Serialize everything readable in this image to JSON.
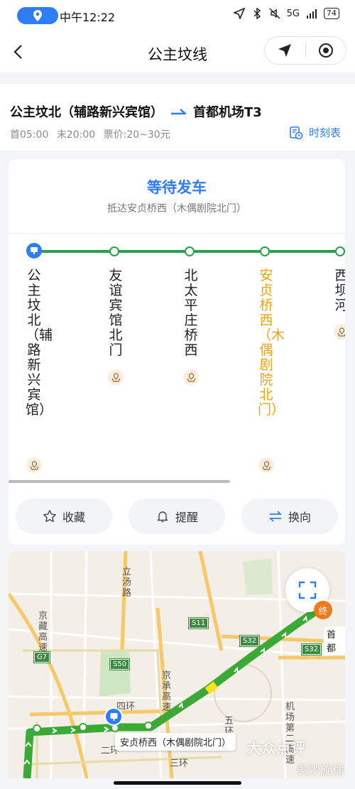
{
  "status_bar": {
    "time": "中午12:22",
    "network": "5G",
    "battery": "74"
  },
  "nav": {
    "title": "公主坟线"
  },
  "route": {
    "from": "公主坟北（辅路新兴宾馆）",
    "to": "首都机场T3",
    "first_bus": "首05:00",
    "last_bus": "末20:00",
    "fare": "票价:20~30元",
    "timetable_label": "时刻表"
  },
  "status_card": {
    "status": "等待发车",
    "arrival_note": "抵达安贞桥西（木偶剧院北门）"
  },
  "stops": [
    {
      "name": "公主坟北（辅路新兴宾馆）",
      "current": false
    },
    {
      "name": "友谊宾馆北门",
      "current": false
    },
    {
      "name": "北太平庄桥西",
      "current": false
    },
    {
      "name": "安贞桥西（木偶剧院北门）",
      "current": true
    },
    {
      "name": "西坝河",
      "current": false
    }
  ],
  "actions": {
    "favorite": "收藏",
    "remind": "提醒",
    "switch": "换向"
  },
  "map": {
    "labels": {
      "lishui": "立汤路",
      "jingzang": "京藏高速",
      "jingcheng": "京承高速",
      "sihuan": "四环",
      "erhuan": "二环",
      "sanhuan": "三环",
      "wuhuan": "五环",
      "airport_road": "机场第二高速",
      "end_marker": "终",
      "destination": "首都",
      "current_stop": "安贞桥西（木偶剧院北门）",
      "watermark": "大众点评",
      "watermark_sub": "美妙旋律"
    },
    "shields": [
      "S11",
      "S32",
      "S32",
      "S50",
      "G7"
    ],
    "colors": {
      "route": "#27a14a",
      "highlight": "#ffe21a",
      "accent": "#2f7df6",
      "current": "#f0a30a"
    }
  }
}
